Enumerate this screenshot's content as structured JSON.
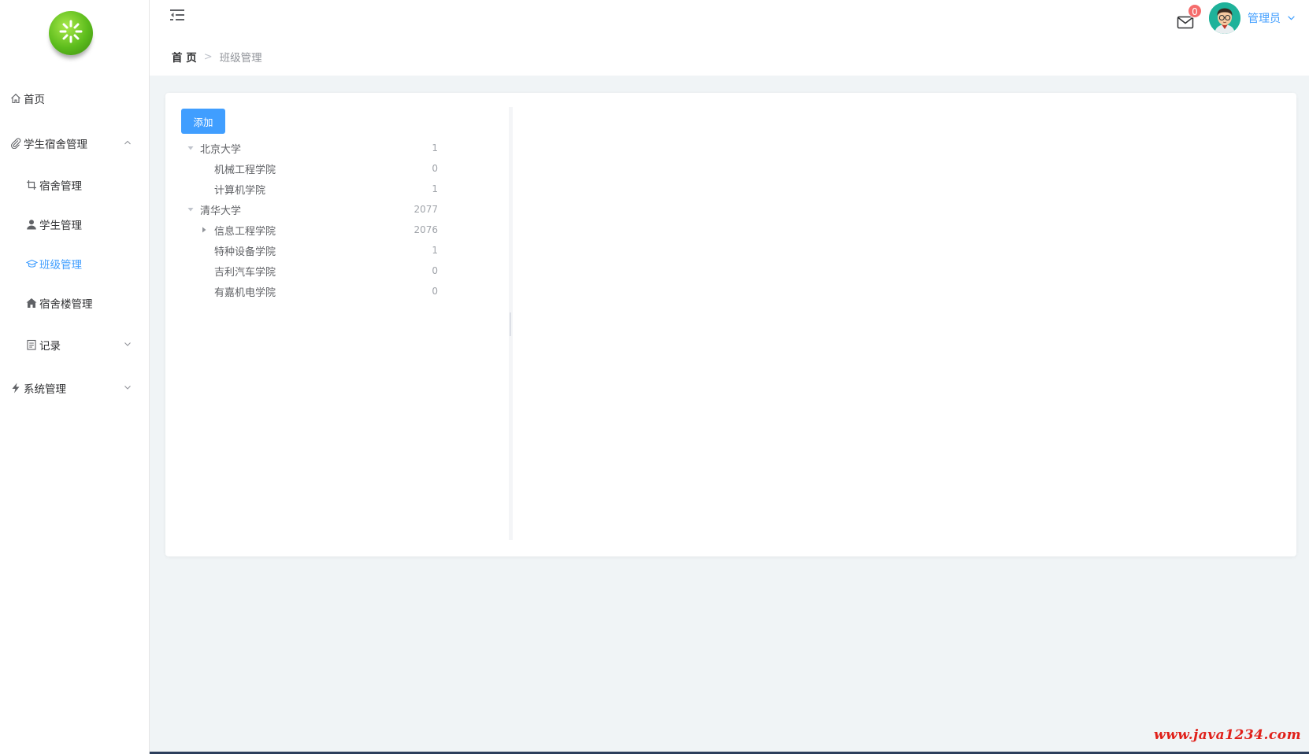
{
  "sidebar": {
    "logo_icon": "sun-logo-icon",
    "items": [
      {
        "label": "首页",
        "icon": "home-icon"
      },
      {
        "label": "学生宿舍管理",
        "icon": "paperclip-icon",
        "expanded": true
      },
      {
        "label": "宿舍管理",
        "icon": "crop-icon"
      },
      {
        "label": "学生管理",
        "icon": "user-icon"
      },
      {
        "label": "班级管理",
        "icon": "graduation-icon",
        "active": true
      },
      {
        "label": "宿舍楼管理",
        "icon": "house-icon"
      },
      {
        "label": "记录",
        "icon": "document-icon",
        "expanded": false
      },
      {
        "label": "系统管理",
        "icon": "lightning-icon",
        "expanded": false
      }
    ]
  },
  "header": {
    "breadcrumb": {
      "home": "首 页",
      "current": "班级管理"
    },
    "message_count": "0",
    "username": "管理员"
  },
  "main": {
    "add_button": "添加",
    "tree": [
      {
        "label": "北京大学",
        "count": "1",
        "level": 0,
        "toggle": "expanded"
      },
      {
        "label": "机械工程学院",
        "count": "0",
        "level": 1,
        "toggle": "none"
      },
      {
        "label": "计算机学院",
        "count": "1",
        "level": 1,
        "toggle": "none"
      },
      {
        "label": "清华大学",
        "count": "2077",
        "level": 0,
        "toggle": "expanded"
      },
      {
        "label": "信息工程学院",
        "count": "2076",
        "level": 1,
        "toggle": "collapsed"
      },
      {
        "label": "特种设备学院",
        "count": "1",
        "level": 1,
        "toggle": "none"
      },
      {
        "label": "吉利汽车学院",
        "count": "0",
        "level": 1,
        "toggle": "none"
      },
      {
        "label": "有嘉机电学院",
        "count": "0",
        "level": 1,
        "toggle": "none"
      }
    ]
  },
  "watermark": "www.java1234.com",
  "colors": {
    "accent": "#409eff",
    "badge": "#f56c6c",
    "watermark": "#e0201a"
  }
}
